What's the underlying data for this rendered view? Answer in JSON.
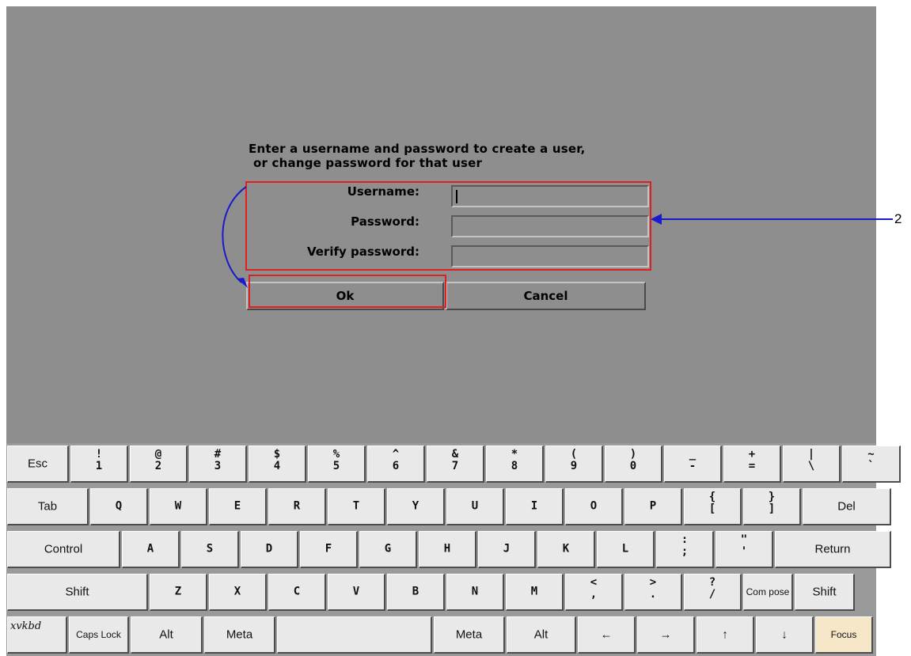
{
  "dialog": {
    "prompt_line1": "Enter a username and password to create a user,",
    "prompt_line2": "or change password for that user",
    "fields": [
      {
        "label": "Username:",
        "value": ""
      },
      {
        "label": "Password:",
        "value": ""
      },
      {
        "label": "Verify password:",
        "value": ""
      }
    ],
    "ok_label": "Ok",
    "cancel_label": "Cancel"
  },
  "annotation": {
    "callout_number": "2",
    "arrow_color": "#1a1acc",
    "highlight_color": "#e02020"
  },
  "keyboard": {
    "logo": "xvkbd",
    "row1": [
      {
        "label": "Esc"
      },
      {
        "upper": "!",
        "lower": "1"
      },
      {
        "upper": "@",
        "lower": "2"
      },
      {
        "upper": "#",
        "lower": "3"
      },
      {
        "upper": "$",
        "lower": "4"
      },
      {
        "upper": "%",
        "lower": "5"
      },
      {
        "upper": "^",
        "lower": "6"
      },
      {
        "upper": "&",
        "lower": "7"
      },
      {
        "upper": "*",
        "lower": "8"
      },
      {
        "upper": "(",
        "lower": "9"
      },
      {
        "upper": ")",
        "lower": "0"
      },
      {
        "upper": "_",
        "lower": "-"
      },
      {
        "upper": "+",
        "lower": "="
      },
      {
        "upper": "|",
        "lower": "\\"
      },
      {
        "upper": "~",
        "lower": "`"
      }
    ],
    "row2": [
      "Tab",
      "Q",
      "W",
      "E",
      "R",
      "T",
      "Y",
      "U",
      "I",
      "O",
      "P",
      {
        "upper": "{",
        "lower": "["
      },
      {
        "upper": "}",
        "lower": "]"
      },
      "Del"
    ],
    "row3": [
      "Control",
      "A",
      "S",
      "D",
      "F",
      "G",
      "H",
      "J",
      "K",
      "L",
      {
        "upper": ":",
        "lower": ";"
      },
      {
        "upper": "\"",
        "lower": "'"
      },
      "Return"
    ],
    "row4": [
      "Shift",
      "Z",
      "X",
      "C",
      "V",
      "B",
      "N",
      "M",
      {
        "upper": "<",
        "lower": ","
      },
      {
        "upper": ">",
        "lower": "."
      },
      {
        "upper": "?",
        "lower": "/"
      },
      "Com pose",
      "Shift"
    ],
    "row5": [
      "Caps Lock",
      "Alt",
      "Meta",
      "",
      "Meta",
      "Alt",
      "←",
      "→",
      "↑",
      "↓",
      "Focus"
    ],
    "focus_color": "#f6e7c8"
  }
}
